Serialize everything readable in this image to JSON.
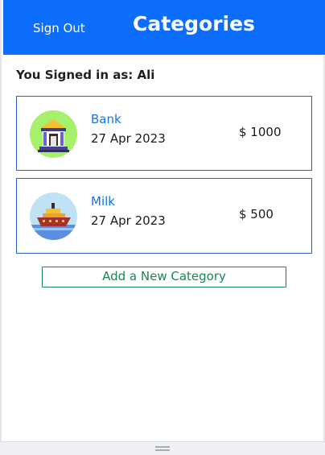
{
  "header": {
    "sign_out_label": "Sign Out",
    "title": "Categories"
  },
  "user": {
    "signed_in_text": "You Signed in as: Ali"
  },
  "categories": [
    {
      "name": "Bank",
      "date": "27 Apr 2023",
      "amount": "$ 1000",
      "icon": "bank-building-icon"
    },
    {
      "name": "Milk",
      "date": "27 Apr 2023",
      "amount": "$ 500",
      "icon": "ship-icon"
    }
  ],
  "actions": {
    "add_category_label": "Add a New Category"
  },
  "colors": {
    "header_bg": "#0d6efd",
    "card_border": "#2f62c7",
    "category_name": "#1473e6",
    "add_button": "#198754"
  }
}
